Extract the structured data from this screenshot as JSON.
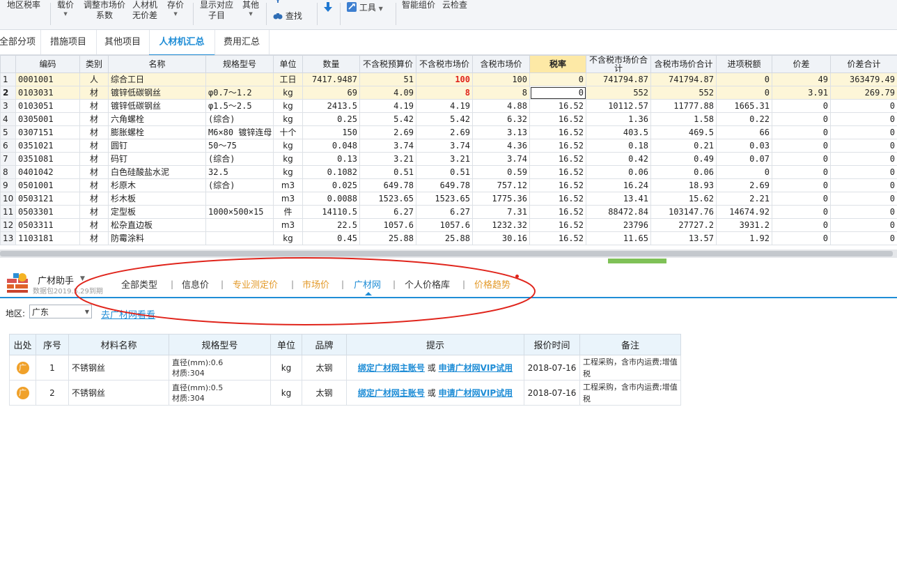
{
  "toolbar": {
    "region_tax": "地区税率",
    "load_price": "载价",
    "adjust_line1": "调整市场价",
    "adjust_line2": "系数",
    "rcj_line1": "人材机",
    "rcj_line2": "无价差",
    "save_price": "存价",
    "show_line1": "显示对应",
    "show_line2": "子目",
    "other": "其他",
    "find": "查找",
    "tools": "工具",
    "smart_price": "智能组价",
    "cloud_check": "云检查"
  },
  "tabs": [
    "全部分项",
    "措施项目",
    "其他项目",
    "人材机汇总",
    "费用汇总"
  ],
  "active_tab": "人材机汇总",
  "grid": {
    "headers": [
      "编码",
      "类别",
      "名称",
      "规格型号",
      "单位",
      "数量",
      "不含税预算价",
      "不含税市场价",
      "含税市场价",
      "税率",
      "不含税市场价合计",
      "含税市场价合计",
      "进项税额",
      "价差",
      "价差合计"
    ],
    "rows": [
      [
        "1",
        "0001001",
        "人",
        "综合工日",
        "",
        "工日",
        "7417.9487",
        "51",
        "100",
        "100",
        "0",
        "741794.87",
        "741794.87",
        "0",
        "49",
        "363479.49"
      ],
      [
        "2",
        "0103031",
        "材",
        "镀锌低碳钢丝",
        "φ0.7～1.2",
        "kg",
        "69",
        "4.09",
        "8",
        "8",
        "0",
        "552",
        "552",
        "0",
        "3.91",
        "269.79"
      ],
      [
        "3",
        "0103051",
        "材",
        "镀锌低碳钢丝",
        "φ1.5～2.5",
        "kg",
        "2413.5",
        "4.19",
        "4.19",
        "4.88",
        "16.52",
        "10112.57",
        "11777.88",
        "1665.31",
        "0",
        "0"
      ],
      [
        "4",
        "0305001",
        "材",
        "六角螺栓",
        "(综合)",
        "kg",
        "0.25",
        "5.42",
        "5.42",
        "6.32",
        "16.52",
        "1.36",
        "1.58",
        "0.22",
        "0",
        "0"
      ],
      [
        "5",
        "0307151",
        "材",
        "膨胀螺栓",
        "M6×80 镀锌连母",
        "十个",
        "150",
        "2.69",
        "2.69",
        "3.13",
        "16.52",
        "403.5",
        "469.5",
        "66",
        "0",
        "0"
      ],
      [
        "6",
        "0351021",
        "材",
        "圆钉",
        "50～75",
        "kg",
        "0.048",
        "3.74",
        "3.74",
        "4.36",
        "16.52",
        "0.18",
        "0.21",
        "0.03",
        "0",
        "0"
      ],
      [
        "7",
        "0351081",
        "材",
        "码钉",
        "(综合)",
        "kg",
        "0.13",
        "3.21",
        "3.21",
        "3.74",
        "16.52",
        "0.42",
        "0.49",
        "0.07",
        "0",
        "0"
      ],
      [
        "8",
        "0401042",
        "材",
        "白色硅酸盐水泥",
        "32.5",
        "kg",
        "0.1082",
        "0.51",
        "0.51",
        "0.59",
        "16.52",
        "0.06",
        "0.06",
        "0",
        "0",
        "0"
      ],
      [
        "9",
        "0501001",
        "材",
        "杉原木",
        "(综合)",
        "m3",
        "0.025",
        "649.78",
        "649.78",
        "757.12",
        "16.52",
        "16.24",
        "18.93",
        "2.69",
        "0",
        "0"
      ],
      [
        "10",
        "0503121",
        "材",
        "杉木板",
        "",
        "m3",
        "0.0088",
        "1523.65",
        "1523.65",
        "1775.36",
        "16.52",
        "13.41",
        "15.62",
        "2.21",
        "0",
        "0"
      ],
      [
        "11",
        "0503301",
        "材",
        "定型板",
        "1000×500×15",
        "件",
        "14110.5",
        "6.27",
        "6.27",
        "7.31",
        "16.52",
        "88472.84",
        "103147.76",
        "14674.92",
        "0",
        "0"
      ],
      [
        "12",
        "0503311",
        "材",
        "松杂直边板",
        "",
        "m3",
        "22.5",
        "1057.6",
        "1057.6",
        "1232.32",
        "16.52",
        "23796",
        "27727.2",
        "3931.2",
        "0",
        "0"
      ],
      [
        "13",
        "1103181",
        "材",
        "防霉涂料",
        "",
        "kg",
        "0.45",
        "25.88",
        "25.88",
        "30.16",
        "16.52",
        "11.65",
        "13.57",
        "1.92",
        "0",
        "0"
      ]
    ]
  },
  "helper": {
    "title": "广材助手",
    "expire": "数据包2019.5.29到期",
    "tabs": [
      "全部类型",
      "信息价",
      "专业测定价",
      "市场价",
      "广材网",
      "个人价格库",
      "价格趋势"
    ],
    "active_tab": "广材网",
    "region_label": "地区:",
    "region_value": "广东",
    "goto_link": "去广材网看看"
  },
  "lower_table": {
    "headers": [
      "出处",
      "序号",
      "材料名称",
      "规格型号",
      "单位",
      "品牌",
      "提示",
      "报价时间",
      "备注"
    ],
    "rows": [
      {
        "src": "广",
        "no": "1",
        "name": "不锈钢丝",
        "spec1": "直径(mm):0.6",
        "spec2": "材质:304",
        "unit": "kg",
        "brand": "太钢",
        "hint_link1": "绑定广材网主账号",
        "hint_or": "或",
        "hint_link2": "申请广材网VIP试用",
        "date": "2018-07-16",
        "note": "工程采购，含市内运费;增值税"
      },
      {
        "src": "广",
        "no": "2",
        "name": "不锈钢丝",
        "spec1": "直径(mm):0.5",
        "spec2": "材质:304",
        "unit": "kg",
        "brand": "太钢",
        "hint_link1": "绑定广材网主账号",
        "hint_or": "或",
        "hint_link2": "申请广材网VIP试用",
        "date": "2018-07-16",
        "note": "工程采购，含市内运费;增值税"
      }
    ]
  },
  "colors": {
    "accent": "#1f8dd6",
    "highlight_row": "#fdf6d8",
    "red_value": "#e0241b",
    "orange_tab": "#e39a2a",
    "annotation_ellipse": "#e0241b"
  }
}
